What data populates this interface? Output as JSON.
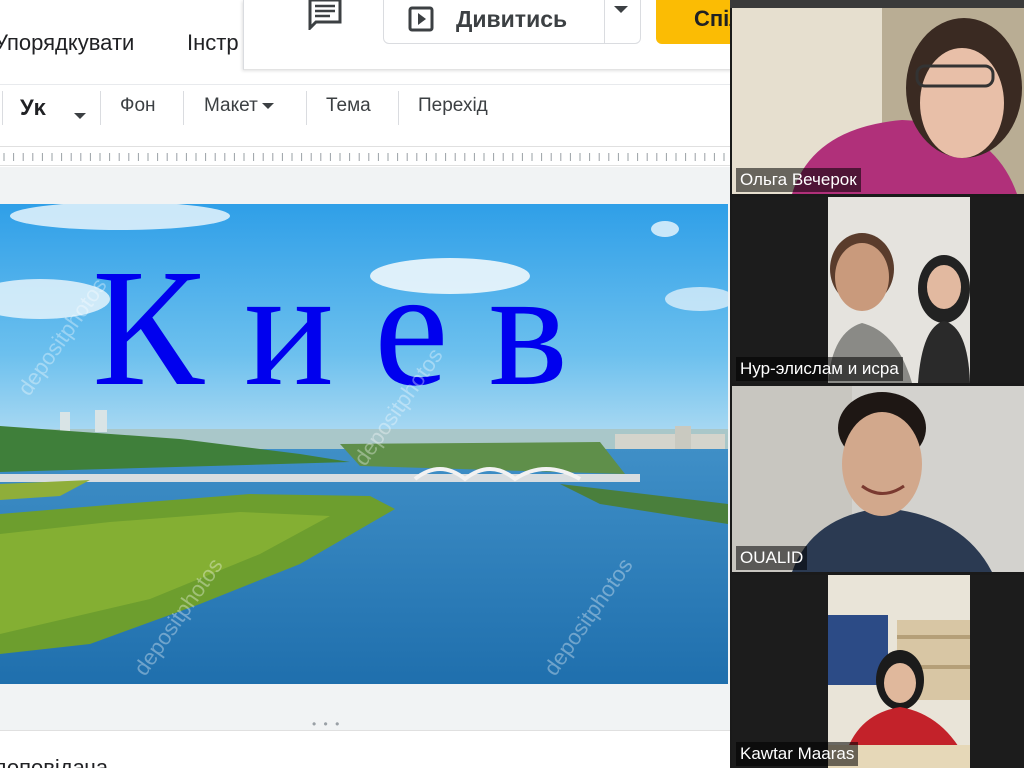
{
  "menu": {
    "arrange_label": "Упорядкувати",
    "tools_label": "Інстр"
  },
  "header": {
    "watch_label": "Дивитись",
    "share_label": "Спільний доступ",
    "share_color": "#fbbc04"
  },
  "toolbar": {
    "font_format_label": "Уκ",
    "background_label": "Фон",
    "layout_label": "Макет",
    "theme_label": "Тема",
    "transition_label": "Перехід"
  },
  "slide": {
    "title": "Киев",
    "title_color": "#0000ee",
    "watermark_text": "depositphotos"
  },
  "notes": {
    "label": "доповідача"
  },
  "participants": [
    {
      "name": "Ольга Вечерок",
      "active": false
    },
    {
      "name": "Нур-элислам и исра",
      "active": false
    },
    {
      "name": "OUALID",
      "active": true
    },
    {
      "name": "Kawtar Maaras",
      "active": false
    }
  ],
  "colors": {
    "active_speaker_border": "#8fd05c",
    "call_panel_bg": "#1a1a1a"
  }
}
